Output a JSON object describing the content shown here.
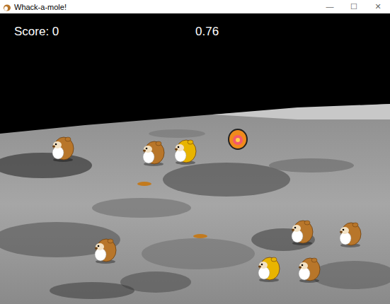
{
  "window": {
    "title": "Whack-a-mole!",
    "controls": [
      "—",
      "☐",
      "✕"
    ]
  },
  "hud": {
    "score": "Score: 0",
    "timer": "0.76"
  },
  "moles": [
    {
      "kind": "brown"
    },
    {
      "kind": "brown"
    },
    {
      "kind": "yellow"
    },
    {
      "kind": "bomb"
    },
    {
      "kind": "hole"
    },
    {
      "kind": "hole"
    },
    {
      "kind": "brown"
    },
    {
      "kind": "brown"
    },
    {
      "kind": "brown"
    },
    {
      "kind": "yellow"
    },
    {
      "kind": "brown"
    }
  ]
}
